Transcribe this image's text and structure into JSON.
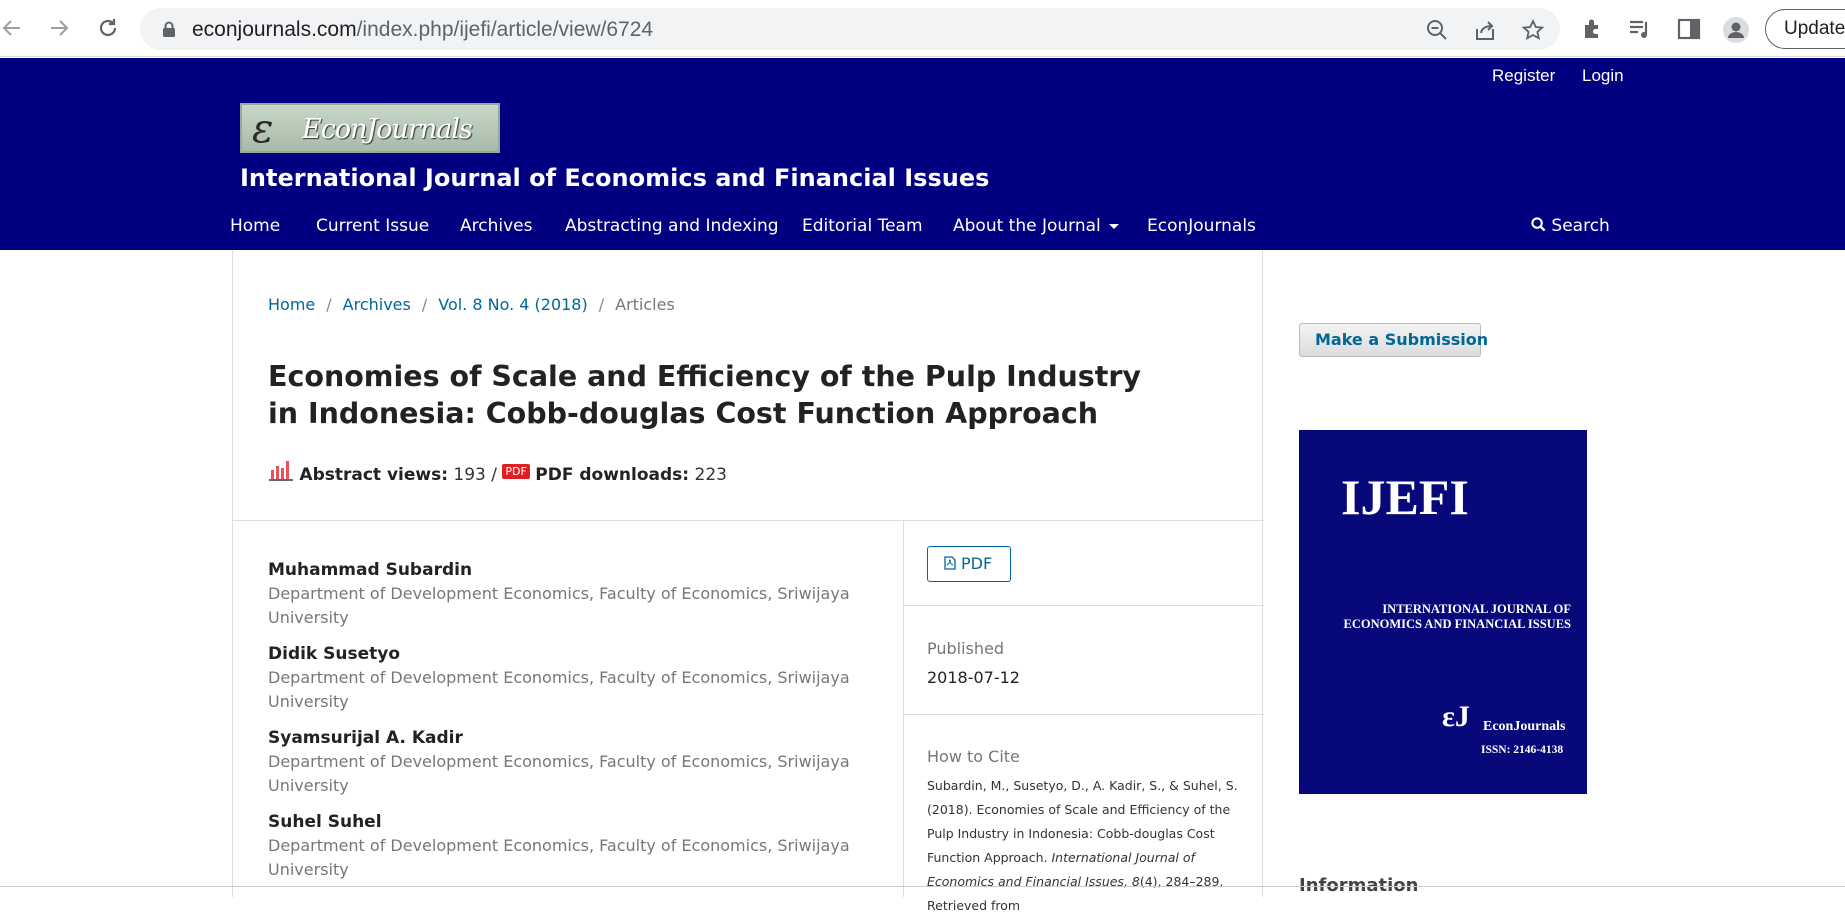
{
  "browser": {
    "url_host": "econjournals.com",
    "url_path": "/index.php/ijefi/article/view/6724",
    "update_label": "Update"
  },
  "header": {
    "logo_letter": "ε",
    "logo_text": "EconJournals",
    "site_title": "International Journal of Economics and Financial Issues",
    "user_nav": {
      "register": "Register",
      "login": "Login"
    },
    "nav": {
      "home": "Home",
      "current_issue": "Current Issue",
      "archives": "Archives",
      "abstracting": "Abstracting and Indexing",
      "editorial": "Editorial Team",
      "about": "About the Journal",
      "econjournals": "EconJournals",
      "search": "Search"
    }
  },
  "breadcrumb": {
    "home": "Home",
    "archives": "Archives",
    "issue": "Vol. 8 No. 4 (2018)",
    "current": "Articles",
    "separator": "/"
  },
  "article": {
    "title": "Economies of Scale and Efficiency of the Pulp Industry in Indonesia: Cobb-douglas Cost Function Approach",
    "stats": {
      "abstract_label": "Abstract views:",
      "abstract_value": "193",
      "divider": "/",
      "pdf_badge": "PDF",
      "pdf_label": "PDF downloads:",
      "pdf_value": "223"
    },
    "authors": [
      {
        "name": "Muhammad Subardin",
        "affiliation": "Department of Development Economics, Faculty of Economics, Sriwijaya University"
      },
      {
        "name": "Didik Susetyo",
        "affiliation": "Department of Development Economics, Faculty of Economics, Sriwijaya University"
      },
      {
        "name": "Syamsurijal A. Kadir",
        "affiliation": "Department of Development Economics, Faculty of Economics, Sriwijaya University"
      },
      {
        "name": "Suhel Suhel",
        "affiliation": "Department of Development Economics, Faculty of Economics, Sriwijaya University"
      }
    ],
    "pdf_button": "PDF",
    "published_label": "Published",
    "published_date": "2018-07-12",
    "cite_label": "How to Cite",
    "cite_plain": "Subardin, M., Susetyo, D., A. Kadir, S., & Suhel, S. (2018). Economies of Scale and Efficiency of the Pulp Industry in Indonesia: Cobb-douglas Cost Function Approach. ",
    "cite_italic": "International Journal of Economics and Financial Issues, 8",
    "cite_tail": "(4), 284–289. Retrieved from"
  },
  "sidebar": {
    "submit_button": "Make a Submission",
    "cover": {
      "title": "IJEFI",
      "subtitle": "INTERNATIONAL JOURNAL OF ECONOMICS AND FINANCIAL ISSUES",
      "ej_mark": "εJ",
      "ej_text": "EconJournals",
      "issn": "ISSN: 2146-4138"
    },
    "info_heading": "Information"
  },
  "colors": {
    "header_bg": "#000080",
    "link": "#006798",
    "cover_bg": "#07087a"
  }
}
